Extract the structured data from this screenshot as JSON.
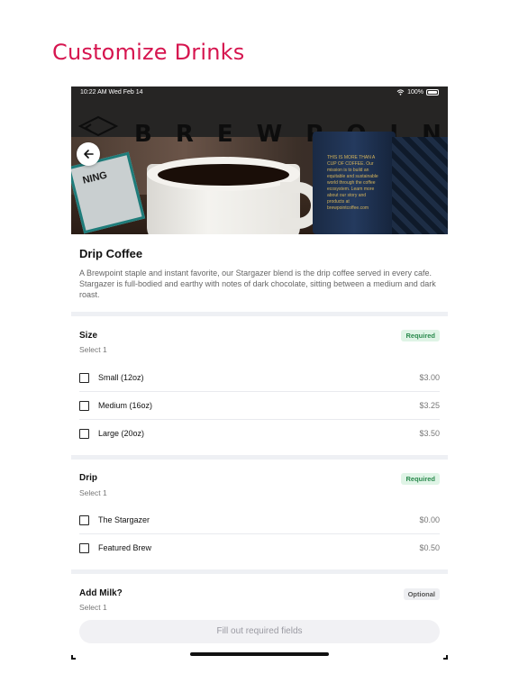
{
  "headline": "Customize Drinks",
  "status_bar": {
    "time": "10:22 AM  Wed Feb 14",
    "battery": "100%"
  },
  "hero": {
    "brand_text": "BREWPOINT",
    "sign_text": "NING",
    "cup_text": "THIS IS MORE THAN A CUP OF COFFEE. Our mission is to build an equitable and sustainable world through the coffee ecosystem. Learn more about our story and products at brewpointcoffee.com"
  },
  "product": {
    "title": "Drip Coffee",
    "description": "A Brewpoint staple and instant favorite, our Stargazer blend is the drip coffee served in every cafe. Stargazer is full-bodied and earthy with notes of dark chocolate, sitting between a medium and dark roast."
  },
  "sections": [
    {
      "title": "Size",
      "subtitle": "Select 1",
      "badge": "Required",
      "options": [
        {
          "label": "Small (12oz)",
          "price": "$3.00"
        },
        {
          "label": "Medium (16oz)",
          "price": "$3.25"
        },
        {
          "label": "Large (20oz)",
          "price": "$3.50"
        }
      ]
    },
    {
      "title": "Drip",
      "subtitle": "Select 1",
      "badge": "Required",
      "options": [
        {
          "label": "The Stargazer",
          "price": "$0.00"
        },
        {
          "label": "Featured Brew",
          "price": "$0.50"
        }
      ]
    },
    {
      "title": "Add Milk?",
      "subtitle": "Select 1",
      "badge": "Optional",
      "options": []
    }
  ],
  "cta_label": "Fill out required fields",
  "colors": {
    "headline": "#d6154f",
    "required_bg": "#dff4e6",
    "required_text": "#2b8a4e"
  }
}
